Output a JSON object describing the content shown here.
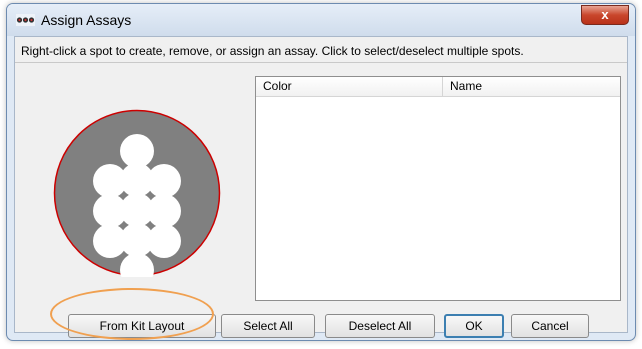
{
  "window": {
    "title": "Assign Assays",
    "close_glyph": "x",
    "app_icon": "assay-wells-icon"
  },
  "instruction": "Right-click a spot to create, remove, or assign an assay.  Click to select/deselect multiple spots.",
  "spot_disk": {
    "disk_color": "#808080",
    "rim_color": "#cc0000",
    "spot_color": "#ffffff",
    "spot_count": 13
  },
  "table": {
    "columns": [
      "Color",
      "Name"
    ],
    "rows": []
  },
  "buttons": {
    "from_kit_layout": "From Kit Layout",
    "select_all": "Select All",
    "deselect_all": "Deselect All",
    "ok": "OK",
    "cancel": "Cancel"
  },
  "annotation_color": "#f0a050"
}
